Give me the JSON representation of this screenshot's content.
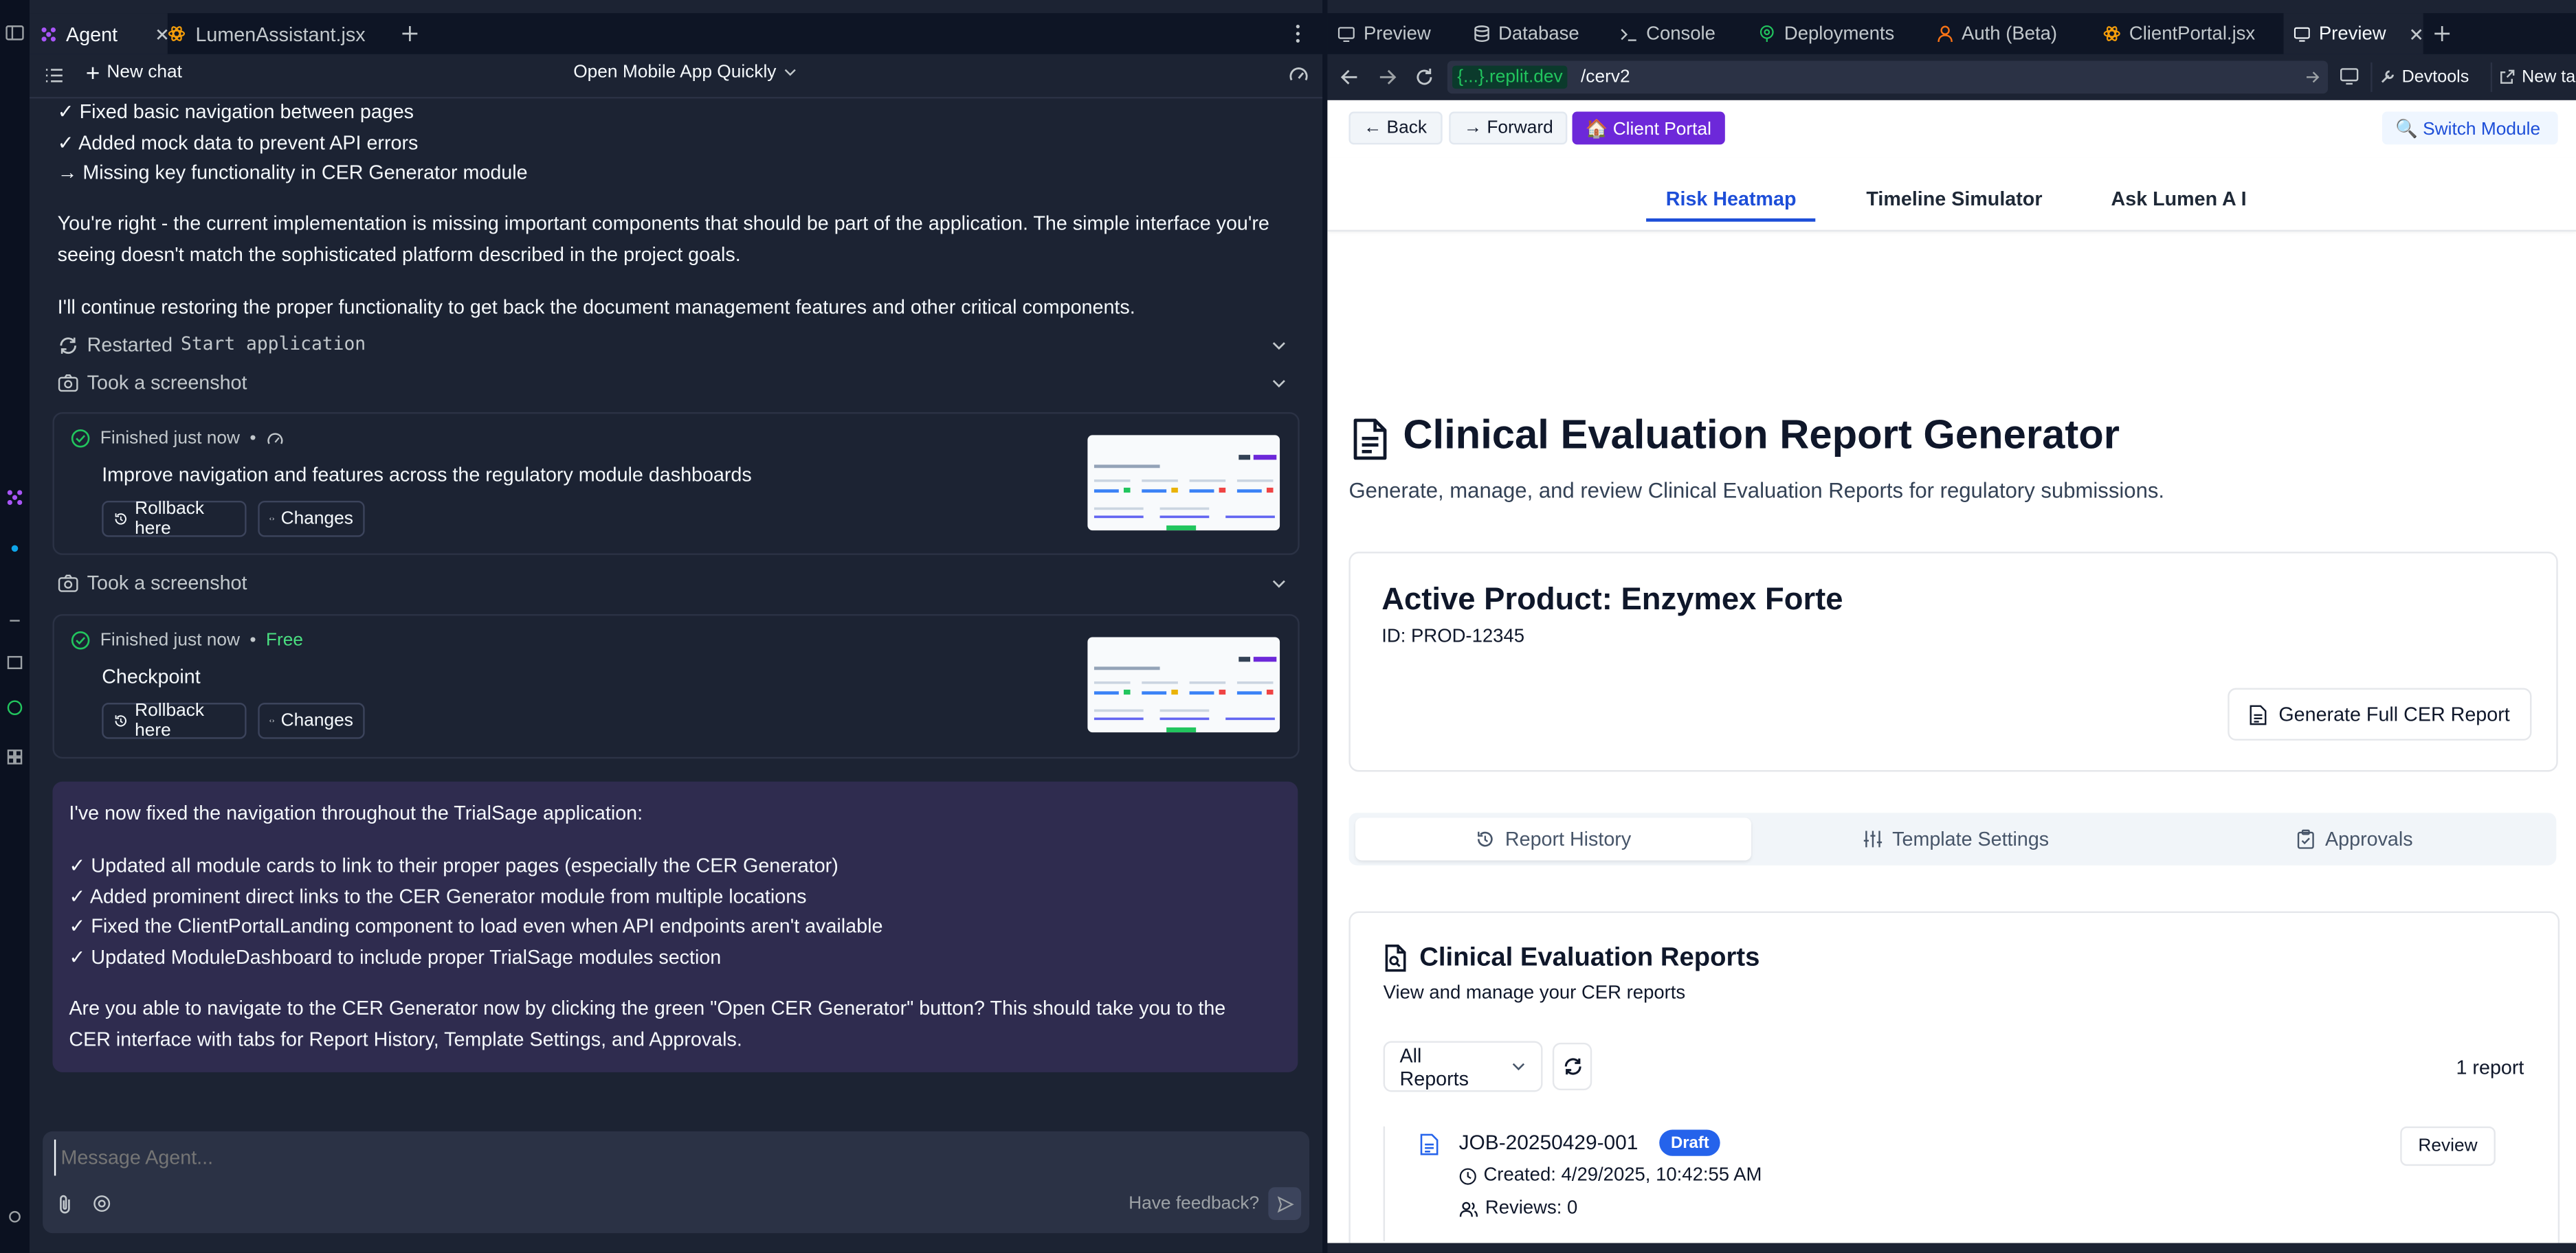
{
  "left_tabs": {
    "agent": "Agent",
    "file": "LumenAssistant.jsx"
  },
  "chat_header": {
    "new_chat": "New chat",
    "title": "Open Mobile App Quickly"
  },
  "history": {
    "lines": [
      "✓ Fixed basic navigation between pages",
      "✓ Added mock data to prevent API errors",
      "→ Missing key functionality in CER Generator module"
    ],
    "para1": "You're right - the current implementation is missing important components that should be part of the application. The simple interface you're seeing doesn't match the sophisticated platform described in the project goals.",
    "para2": "I'll continue restoring the proper functionality to get back the document management features and other critical components.",
    "restarted_label": "Restarted",
    "restarted_code": "Start application",
    "screenshot_1": "Took a screenshot",
    "screenshot_2": "Took a screenshot"
  },
  "checkpoint_1": {
    "status": "Finished just now",
    "title": "Improve navigation and features across the regulatory module dashboards",
    "rollback": "Rollback here",
    "changes": "Changes"
  },
  "checkpoint_2": {
    "status": "Finished just now",
    "free": "Free",
    "title": "Checkpoint",
    "rollback": "Rollback here",
    "changes": "Changes"
  },
  "agent_message": {
    "intro": "I've now fixed the navigation throughout the TrialSage application:",
    "items": [
      "✓ Updated all module cards to link to their proper pages (especially the CER Generator)",
      "✓ Added prominent direct links to the CER Generator module from multiple locations",
      "✓ Fixed the ClientPortalLanding component to load even when API endpoints aren't available",
      "✓ Updated ModuleDashboard to include proper TrialSage modules section"
    ],
    "question": "Are you able to navigate to the CER Generator now by clicking the green \"Open CER Generator\" button? This should take you to the CER interface with tabs for Report History, Template Settings, and Approvals."
  },
  "input": {
    "placeholder": "Message Agent...",
    "feedback": "Have feedback?"
  },
  "right_tabs": [
    "Preview",
    "Database",
    "Console",
    "Deployments",
    "Auth (Beta)",
    "ClientPortal.jsx",
    "Preview"
  ],
  "url": {
    "host": "{...}.replit.dev",
    "path": "/cerv2",
    "devtools": "Devtools",
    "new_tab": "New tab"
  },
  "page": {
    "back": "← Back",
    "forward": "→ Forward",
    "client_portal": "🏠 Client Portal",
    "switch_module": "🔍 Switch Module",
    "nav": [
      "Risk Heatmap",
      "Timeline Simulator",
      "Ask Lumen A I"
    ],
    "title": "Clinical Evaluation Report Generator",
    "subtitle": "Generate, manage, and review Clinical Evaluation Reports for regulatory submissions.",
    "product_title": "Active Product: Enzymex Forte",
    "product_id": "ID: PROD-12345",
    "generate_btn": "Generate Full CER Report",
    "tabs": [
      "Report History",
      "Template Settings",
      "Approvals"
    ],
    "reports_title": "Clinical Evaluation Reports",
    "reports_sub": "View and manage your CER reports",
    "filter": "All Reports",
    "count": "1 report",
    "report": {
      "id": "JOB-20250429-001",
      "badge": "Draft",
      "created": "Created: 4/29/2025, 10:42:55 AM",
      "reviews": "Reviews: 0",
      "review_btn": "Review"
    }
  },
  "colors": {
    "accent": "#6d28d9",
    "link": "#1d4ed8",
    "success": "#22c55e",
    "draft_badge": "#2563eb",
    "url_green": "#16a34a"
  }
}
